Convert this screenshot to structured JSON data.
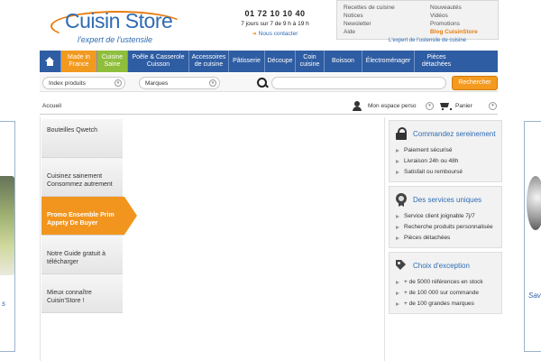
{
  "brand": {
    "name": "Cuisin Store",
    "tagline": "l'expert de l'ustensile"
  },
  "contact": {
    "phone": "01 72 10 10 40",
    "hours": "7 jours sur 7 de 9 h à 19 h",
    "link": "Nous contacter"
  },
  "toplinks": {
    "col1": [
      "Recettes de cuisine",
      "Notices",
      "Newsletter",
      "Aide"
    ],
    "col2": [
      "Nouveautés",
      "Vidéos",
      "Promotions",
      "Blog CuisinStore"
    ]
  },
  "subtagline": "L'expert de l'ustensile de cuisine",
  "nav": {
    "items": [
      {
        "label": "Made in France",
        "color": "#f29a1f"
      },
      {
        "label": "Cuisine Saine",
        "color": "#8fbe3c"
      },
      {
        "label": "Poêle & Casserole Cuisson",
        "color": "#2f5da3"
      },
      {
        "label": "Accessoires de cuisine",
        "color": "#2f5da3"
      },
      {
        "label": "Pâtisserie",
        "color": "#2f5da3"
      },
      {
        "label": "Découpe",
        "color": "#2f5da3"
      },
      {
        "label": "Coin cuisine",
        "color": "#2f5da3"
      },
      {
        "label": "Boisson",
        "color": "#2f5da3"
      },
      {
        "label": "Électroménager",
        "color": "#2f5da3"
      },
      {
        "label": "Pièces détachées",
        "color": "#2f5da3"
      }
    ]
  },
  "search": {
    "index_label": "Index produits",
    "brands_label": "Marques",
    "query": "",
    "button": "Rechercher"
  },
  "breadcrumb": "Accueil",
  "account": {
    "espace": "Mon espace perso",
    "cart": "Panier"
  },
  "menu": [
    {
      "label": "Bouteilles Qwetch",
      "active": false
    },
    {
      "label": "Cuisinez sainement Consommez autrement",
      "active": false
    },
    {
      "label": "Promo Ensemble Prim Appety De Buyer",
      "active": true
    },
    {
      "label": "Notre Guide gratuit à télécharger",
      "active": false
    },
    {
      "label": "Mieux connaître Cuisin'Store !",
      "active": false
    }
  ],
  "panels": [
    {
      "title": "Commandez sereinement",
      "icon": "lock-icon",
      "items": [
        "Paiement sécurisé",
        "Livraison 24h ou 48h",
        "Satisfait ou remboursé"
      ]
    },
    {
      "title": "Des services uniques",
      "icon": "medal-icon",
      "items": [
        "Service client joignable 7j/7",
        "Recherche produits personnalisée",
        "Pièces détachées"
      ]
    },
    {
      "title": "Choix d'exception",
      "icon": "tag-icon",
      "items": [
        "+ de 5000 références en stock",
        "+ de 100 000 sur commande",
        "+ de 100 grandes marques"
      ]
    }
  ],
  "side": {
    "left_text": "s",
    "right_text": "Sav"
  },
  "colors": {
    "brand_blue": "#2f6bb3",
    "nav_blue": "#2f5da3",
    "accent_orange": "#f29a1f",
    "accent_green": "#8fbe3c"
  }
}
